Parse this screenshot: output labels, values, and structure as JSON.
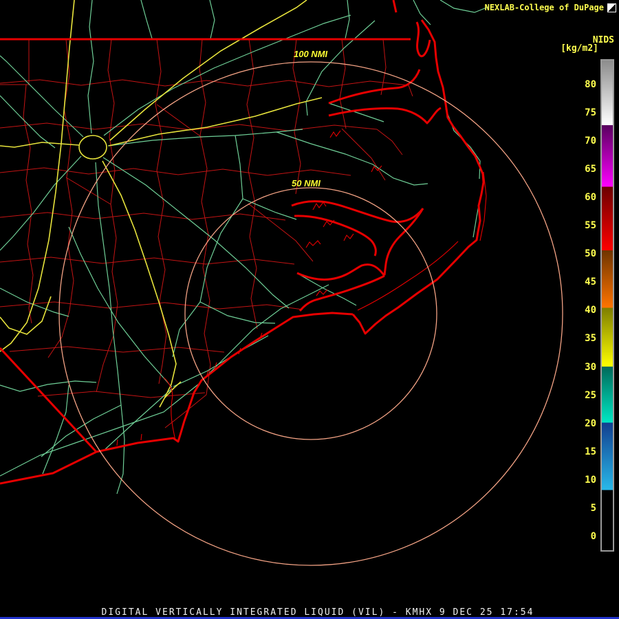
{
  "header": {
    "brand": "NEXLAB-College of DuPage",
    "logo_icon": "college-of-dupage-logo"
  },
  "legend": {
    "title": "NIDS",
    "units": "[kg/m2]"
  },
  "colorbar": {
    "value_top": 84.5,
    "value_bottom": -2.7,
    "ticks": [
      80,
      75,
      70,
      65,
      60,
      55,
      50,
      45,
      40,
      35,
      30,
      25,
      20,
      15,
      10,
      5,
      0
    ],
    "segments": [
      {
        "from": 84.5,
        "to": 73,
        "color_top": "#8c8c8c",
        "color_bottom": "#ffffff"
      },
      {
        "from": 73,
        "to": 62,
        "color_top": "#58005e",
        "color_bottom": "#ff00ff"
      },
      {
        "from": 62,
        "to": 50.7,
        "color_top": "#6b0000",
        "color_bottom": "#ff0000"
      },
      {
        "from": 50.7,
        "to": 40.5,
        "color_top": "#6e3400",
        "color_bottom": "#ff7400"
      },
      {
        "from": 40.5,
        "to": 30,
        "color_top": "#7d7d00",
        "color_bottom": "#ffff00"
      },
      {
        "from": 30,
        "to": 20,
        "color_top": "#00695a",
        "color_bottom": "#00e8c4"
      },
      {
        "from": 20,
        "to": 8,
        "color_top": "#123f8f",
        "color_bottom": "#29b9ea"
      },
      {
        "from": 8,
        "to": -2.7,
        "color_top": "#000000",
        "color_bottom": "#000000"
      }
    ],
    "border_color": "#9a9a9a",
    "tick_color": "#ffff4f"
  },
  "map": {
    "ring_labels": [
      {
        "text": "50 NMI"
      },
      {
        "text": "100 NMI"
      }
    ],
    "colors": {
      "county": "#c41414",
      "coast": "#e60000",
      "road_green": "#6fcf97",
      "road_yellow": "#e8e43c",
      "ring": "#f4a385",
      "label": "#ffff33"
    }
  },
  "footer": {
    "caption": "DIGITAL VERTICALLY INTEGRATED LIQUID (VIL) - KMHX 9 DEC 25 17:54",
    "bar_color": "#2233cc"
  }
}
